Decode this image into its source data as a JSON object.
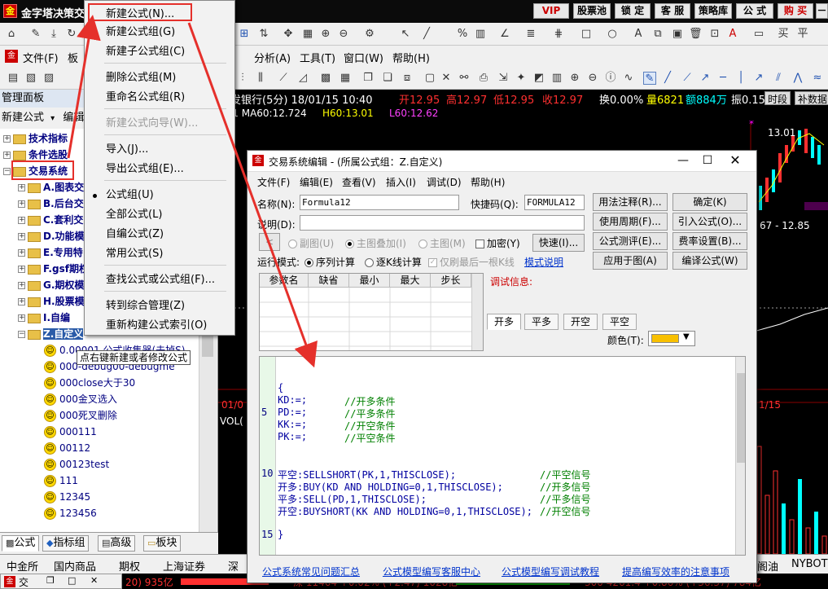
{
  "app": {
    "title": "金字塔决策交",
    "top_buttons": [
      "VIP",
      "股票池",
      "锁 定",
      "客 服",
      "策略库",
      "公 式",
      "购 买",
      "－"
    ]
  },
  "menubar": {
    "items": [
      "文件(F)",
      "板",
      "分析(A)",
      "工具(T)",
      "窗口(W)",
      "帮助(H)"
    ]
  },
  "left_panel": {
    "title": "管理面板",
    "sub_new": "新建公式",
    "sub_edit": "编辑",
    "tree": [
      {
        "label": "技术指标",
        "exp": "+"
      },
      {
        "label": "条件选股",
        "exp": "+"
      },
      {
        "label": "交易系统",
        "exp": "−"
      },
      {
        "label": "A.图表交",
        "exp": "+"
      },
      {
        "label": "B.后台交",
        "exp": "+"
      },
      {
        "label": "C.套利交",
        "exp": "+"
      },
      {
        "label": "D.功能模",
        "exp": "+"
      },
      {
        "label": "E.专用特",
        "exp": "+"
      },
      {
        "label": "F.gsf期权",
        "exp": "+"
      },
      {
        "label": "G.期权模",
        "exp": "+"
      },
      {
        "label": "H.股票模",
        "exp": "+"
      },
      {
        "label": "I.自编",
        "exp": "+"
      },
      {
        "label": "Z.自定义",
        "exp": "−"
      }
    ],
    "formulas": [
      "0.00001 公式收集器(去掉S)",
      "000-debug00-debugme",
      "000close大于30",
      "000金叉选入",
      "000死叉删除",
      "000111",
      "00112",
      "00123test",
      "111",
      "12345",
      "123456"
    ],
    "tabs": [
      "公式",
      "指标组",
      "高级",
      "板块"
    ]
  },
  "tooltip": "点右键新建或者修改公式",
  "dropdown": {
    "items": [
      {
        "label": "新建公式(N)...",
        "disabled": false
      },
      {
        "label": "新建公式组(G)",
        "disabled": false
      },
      {
        "label": "新建子公式组(C)",
        "disabled": false
      },
      {
        "label": "删除公式组(M)",
        "disabled": false
      },
      {
        "label": "重命名公式组(R)",
        "disabled": false
      },
      {
        "label": "新建公式向导(W)...",
        "disabled": true
      },
      {
        "label": "导入(J)...",
        "disabled": false
      },
      {
        "label": "导出公式组(E)...",
        "disabled": false
      },
      {
        "label": "公式组(U)",
        "disabled": false
      },
      {
        "label": "全部公式(L)",
        "disabled": false
      },
      {
        "label": "自编公式(Z)",
        "disabled": false
      },
      {
        "label": "常用公式(S)",
        "disabled": false
      },
      {
        "label": "查找公式或公式组(F)...",
        "disabled": false
      },
      {
        "label": "转到综合管理(Z)",
        "disabled": false
      },
      {
        "label": "重新构建公式索引(O)",
        "disabled": false
      }
    ]
  },
  "stock": {
    "line1": "浦发银行(5分) 18/01/15 10:40",
    "open": "开12.95",
    "high": "高12.97",
    "low": "低12.95",
    "close": "收12.97",
    "turnover": "换0.00%",
    "volume": "量6821",
    "amount": "额884万",
    "amp": "振0.15",
    "btn_time": "时段",
    "btn_fill": "补数据",
    "line2_a": "111 MA60:12.724",
    "line2_b": "H60:13.01",
    "line2_c": "L60:12.62",
    "price_label": "13.01",
    "range_label": "67 - 12.85",
    "date_left": "01/0",
    "date_right": "1/15",
    "vol_label": "VOL("
  },
  "dialog": {
    "title": "交易系统编辑 - (所属公式组：Z.自定义)",
    "menu": [
      "文件(F)",
      "编辑(E)",
      "查看(V)",
      "插入(I)",
      "调试(D)",
      "帮助(H)"
    ],
    "name_label": "名称(N):",
    "name_value": "Formula12",
    "shortcut_label": "快捷码(Q):",
    "shortcut_value": "FORMULA12",
    "desc_label": "说明(D):",
    "btn_usage": "用法注释(R)...",
    "btn_ok": "确定(K)",
    "btn_period": "使用周期(F)...",
    "btn_import": "引入公式(O)...",
    "btn_test": "公式测评(E)...",
    "btn_fee": "费率设置(B)...",
    "btn_apply": "应用于图(A)",
    "btn_compile": "编译公式(W)",
    "btn_fast": "快速(I)...",
    "radio_sub": "副图(U)",
    "radio_overlay": "主图叠加(I)",
    "radio_main": "主图(M)",
    "chk_encrypt": "加密(Y)",
    "mode_label": "运行模式:",
    "mode_seq": "序列计算",
    "mode_bar": "逐K线计算",
    "chk_lastbar": "仅刷最后一根K线",
    "mode_help": "模式说明",
    "debug_label": "调试信息:",
    "grid_headers": [
      "参数名",
      "缺省",
      "最小",
      "最大",
      "步长"
    ],
    "tabs": [
      "开多",
      "平多",
      "开空",
      "平空"
    ],
    "color_label": "颜色(T):",
    "code": [
      {
        "ln": "",
        "text": ""
      },
      {
        "ln": "",
        "text": "{"
      },
      {
        "ln": "",
        "text": "KD:=;",
        "cmt": "//开多条件"
      },
      {
        "ln": "5",
        "text": "PD:=;",
        "cmt": "//平多条件"
      },
      {
        "ln": "",
        "text": "KK:=;",
        "cmt": "//开空条件"
      },
      {
        "ln": "",
        "text": "PK:=;",
        "cmt": "//平空条件"
      },
      {
        "ln": "",
        "text": ""
      },
      {
        "ln": "",
        "text": ""
      },
      {
        "ln": "10",
        "text": "平空:SELLSHORT(PK,1,THISCLOSE);",
        "cmt": "//平空信号"
      },
      {
        "ln": "",
        "text": "开多:BUY(KD AND HOLDING=0,1,THISCLOSE);",
        "cmt": "//开多信号"
      },
      {
        "ln": "",
        "text": "平多:SELL(PD,1,THISCLOSE);",
        "cmt": "//平多信号"
      },
      {
        "ln": "",
        "text": "开空:BUYSHORT(KK AND HOLDING=0,1,THISCLOSE);",
        "cmt": "//开空信号"
      },
      {
        "ln": "",
        "text": ""
      },
      {
        "ln": "15",
        "text": "}"
      }
    ],
    "links": [
      "公式系统常见问题汇总",
      "公式模型编写客服中心",
      "公式模型编写调试教程",
      "提高编写效率的注意事项"
    ]
  },
  "bottombar": {
    "items": [
      "中金所",
      "国内商品",
      "期权",
      "上海证券",
      "深"
    ],
    "right_items": [
      "阁油",
      "NYBOT"
    ]
  },
  "statusbar": {
    "left": "交",
    "mid": "20) 935亿",
    "center": "深 11464 +0.02% (+2.47) 1028亿",
    "right": "300 4261.4 +0.86% (+36.37) 784亿"
  },
  "colors": {
    "accent_red": "#e5302b",
    "up_red": "#ff3030",
    "link_blue": "#0033cc",
    "code_blue": "#0000a0",
    "comment_green": "#008000"
  }
}
